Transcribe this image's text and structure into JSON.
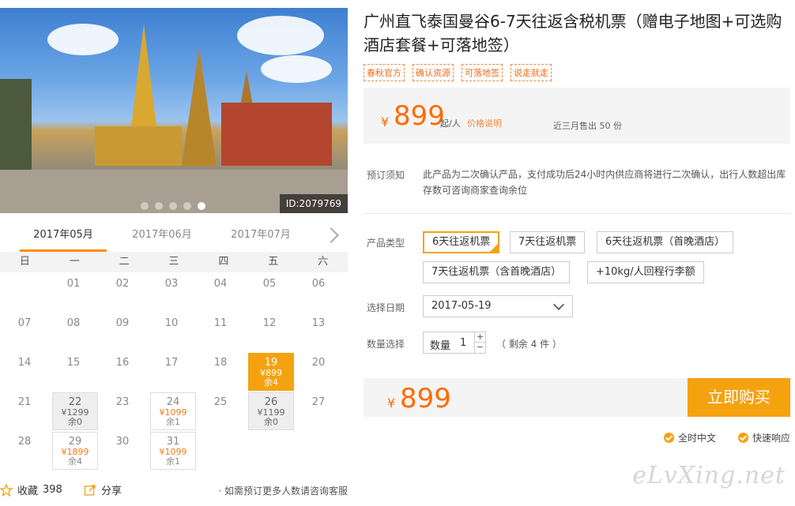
{
  "hero": {
    "image_id": "ID:2079769",
    "dots": 5,
    "active_dot": 4
  },
  "calendar": {
    "months": [
      "2017年05月",
      "2017年06月",
      "2017年07月"
    ],
    "active_month": 0,
    "weekdays": [
      "日",
      "一",
      "二",
      "三",
      "四",
      "五",
      "六"
    ],
    "weeks": [
      [
        {
          "day": ""
        },
        {
          "day": "01"
        },
        {
          "day": "02"
        },
        {
          "day": "03"
        },
        {
          "day": "04"
        },
        {
          "day": "05"
        },
        {
          "day": "06"
        }
      ],
      [
        {
          "day": "07"
        },
        {
          "day": "08"
        },
        {
          "day": "09"
        },
        {
          "day": "10"
        },
        {
          "day": "11"
        },
        {
          "day": "12"
        },
        {
          "day": "13"
        }
      ],
      [
        {
          "day": "14"
        },
        {
          "day": "15"
        },
        {
          "day": "16"
        },
        {
          "day": "17"
        },
        {
          "day": "18"
        },
        {
          "day": "19",
          "price": "¥899",
          "rem": "余4",
          "state": "selected"
        },
        {
          "day": "20"
        }
      ],
      [
        {
          "day": "21"
        },
        {
          "day": "22",
          "price": "¥1299",
          "rem": "余0",
          "state": "soldout"
        },
        {
          "day": "23"
        },
        {
          "day": "24",
          "price": "¥1099",
          "rem": "余1",
          "state": "available"
        },
        {
          "day": "25"
        },
        {
          "day": "26",
          "price": "¥1199",
          "rem": "余0",
          "state": "soldout"
        },
        {
          "day": "27"
        }
      ],
      [
        {
          "day": "28"
        },
        {
          "day": "29",
          "price": "¥1899",
          "rem": "余4",
          "state": "available"
        },
        {
          "day": "30"
        },
        {
          "day": "31",
          "price": "¥1099",
          "rem": "余1",
          "state": "available"
        },
        {
          "day": ""
        },
        {
          "day": ""
        },
        {
          "day": ""
        }
      ]
    ]
  },
  "footer_left": {
    "favorite_label": "收藏",
    "favorite_count": "398",
    "share_label": "分享",
    "note": "· 如需预订更多人数请咨询客服"
  },
  "product": {
    "title": "广州直飞泰国曼谷6-7天往返含税机票（赠电子地图+可选购酒店套餐+可落地签）",
    "tags": [
      "春秋官方",
      "确认资源",
      "可落地签",
      "说走就走"
    ],
    "price_yen": "¥",
    "price": "899",
    "price_unit": "起/人",
    "price_explain": "价格说明",
    "sold": "近三月售出 50 份",
    "notice_label": "预订须知",
    "notice_text": "此产品为二次确认产品，支付成功后24小时内供应商将进行二次确认，出行人数超出库存数可咨询商家查询余位",
    "type_label": "产品类型",
    "types": [
      "6天往返机票",
      "7天往返机票",
      "6天往返机票（首晚酒店）",
      "7天往返机票（含首晚酒店）",
      "+10kg/人回程行李额"
    ],
    "selected_type": 0,
    "date_label": "选择日期",
    "date_value": "2017-05-19",
    "qty_label_row": "数量选择",
    "qty_label": "数量",
    "qty_value": "1",
    "qty_remain": "（ 剩余 4 件 ）",
    "total_yen": "¥",
    "total": "899",
    "buy_label": "立即购买",
    "badges": [
      "全时中文",
      "快速响应"
    ]
  },
  "watermark": "eLvXing.net"
}
